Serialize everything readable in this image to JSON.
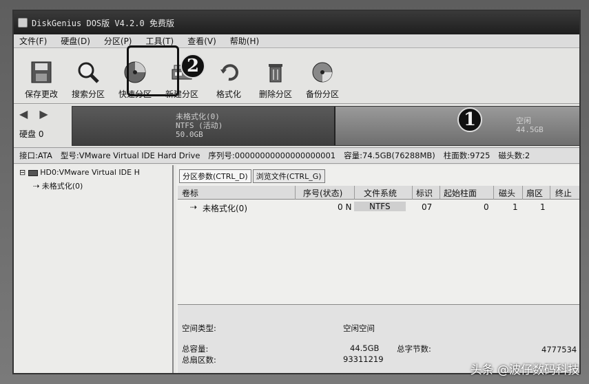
{
  "window": {
    "title": "DiskGenius DOS版 V4.2.0 免费版"
  },
  "menu": [
    "文件(F)",
    "硬盘(D)",
    "分区(P)",
    "工具(T)",
    "查看(V)",
    "帮助(H)"
  ],
  "toolbar": [
    {
      "label": "保存更改",
      "icon": "save-icon"
    },
    {
      "label": "搜索分区",
      "icon": "magnifier-icon"
    },
    {
      "label": "快速分区",
      "icon": "disk-pie-icon"
    },
    {
      "label": "新建分区",
      "icon": "new-partition-icon"
    },
    {
      "label": "格式化",
      "icon": "format-icon"
    },
    {
      "label": "删除分区",
      "icon": "trash-icon"
    },
    {
      "label": "备份分区",
      "icon": "backup-icon"
    }
  ],
  "callouts": {
    "one": "1",
    "two": "2"
  },
  "disk_bar": {
    "nav": "◀ ▶",
    "disk_label": "硬盘 0",
    "unformatted": {
      "line1": "未格式化(0)",
      "line2": "NTFS (活动)",
      "line3": "50.0GB"
    },
    "free": {
      "line1": "空闲",
      "line2": "44.5GB"
    }
  },
  "info": {
    "interface": "接口:ATA",
    "model": "型号:VMware Virtual IDE Hard Drive",
    "serial": "序列号:00000000000000000001",
    "capacity": "容量:74.5GB(76288MB)",
    "cylinders": "柱面数:9725",
    "heads": "磁头数:2"
  },
  "tree": {
    "root": "HD0:VMware Virtual IDE H",
    "child": "未格式化(0)"
  },
  "tabs": [
    "分区参数(CTRL_D)",
    "浏览文件(CTRL_G)"
  ],
  "table": {
    "headers": [
      "卷标",
      "序号(状态)",
      "文件系统",
      "标识",
      "起始柱面",
      "磁头",
      "扇区",
      "终止"
    ],
    "rows": [
      {
        "label": "未格式化(0)",
        "index": "0 N",
        "fs": "NTFS",
        "id": "07",
        "start_cyl": "0",
        "head": "1",
        "sector": "1"
      }
    ]
  },
  "details": {
    "space_type_label": "空间类型:",
    "space_type_value": "空闲空间",
    "total_cap_label": "总容量:",
    "total_cap_value": "44.5GB",
    "total_bytes_label": "总字节数:",
    "total_bytes_value": "4777534",
    "total_sectors_label": "总扇区数:",
    "total_sectors_value": "93311219"
  },
  "watermark": "头条 @波仔数码科技"
}
